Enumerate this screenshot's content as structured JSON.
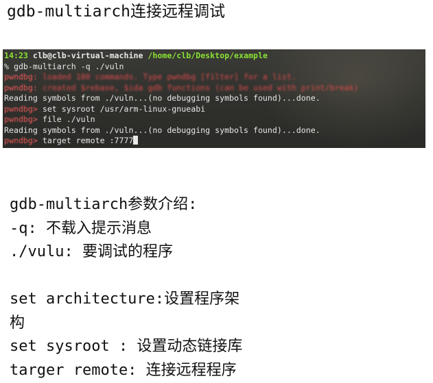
{
  "page": {
    "title": "gdb-multiarch连接远程调试"
  },
  "terminal": {
    "prompt_time": "14:23",
    "prompt_user": "clb@clb-virtual-machine",
    "prompt_path": "/home/clb/Desktop/example",
    "lines": [
      {
        "prefix": "% ",
        "text": "gdb-multiarch -q ./vuln"
      },
      {
        "prefix": "pwndbg: ",
        "text": "loaded 180 commands. Type pwndbg [filter] for a list."
      },
      {
        "prefix": "pwndbg: ",
        "text": "created $rebase, $ida gdb functions (can be used with print/break)"
      },
      {
        "prefix": "",
        "text": "Reading symbols from ./vuln...(no debugging symbols found)...done."
      },
      {
        "prefix": "pwndbg> ",
        "text": "set sysroot /usr/arm-linux-gnueabi"
      },
      {
        "prefix": "pwndbg> ",
        "text": "file ./vuln"
      },
      {
        "prefix": "",
        "text": "Reading symbols from ./vuln...(no debugging symbols found)...done."
      },
      {
        "prefix": "pwndbg> ",
        "text": "target remote :7777"
      }
    ]
  },
  "notes": {
    "heading": "gdb-multiarch参数介绍:",
    "q_option": "-q: 不载入提示消息",
    "vulu": "./vulu: 要调试的程序",
    "set_arch_1": "set architecture:设置程序架",
    "set_arch_2": "构",
    "set_sysroot": "set sysroot : 设置动态链接库",
    "targer_remote": "targer remote: 连接远程程序"
  },
  "colors": {
    "terminal_bg": "#2f302c",
    "prompt_green": "#8ae234",
    "pwndbg_red": "#e34a4a",
    "terminal_text": "#e8e8e8"
  }
}
